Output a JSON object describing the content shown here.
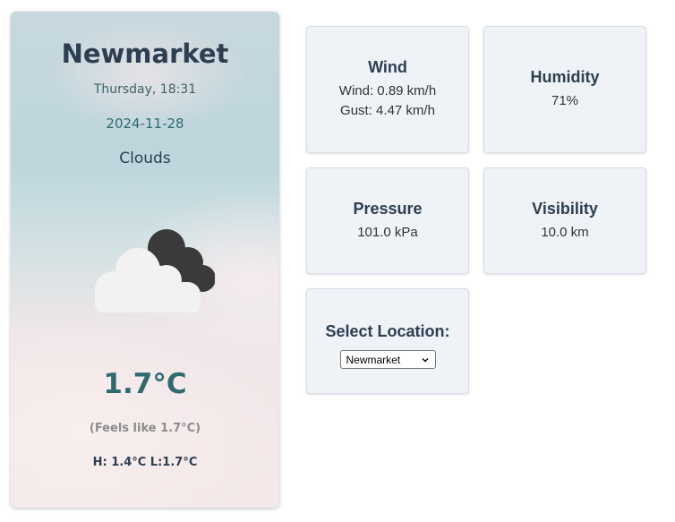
{
  "current": {
    "city": "Newmarket",
    "daytime": "Thursday, 18:31",
    "date": "2024-11-28",
    "condition": "Clouds",
    "condition_icon": "clouds-icon",
    "temperature": "1.7°C",
    "feels_like": "(Feels like 1.7°C)",
    "high_low": "H: 1.4°C L:1.7°C"
  },
  "tiles": {
    "wind": {
      "title": "Wind",
      "speed": "Wind: 0.89 km/h",
      "gust": "Gust: 4.47 km/h"
    },
    "humidity": {
      "title": "Humidity",
      "value": "71%"
    },
    "pressure": {
      "title": "Pressure",
      "value": "101.0 kPa"
    },
    "visibility": {
      "title": "Visibility",
      "value": "10.0 km"
    }
  },
  "location": {
    "label": "Select Location:",
    "selected": "Newmarket"
  },
  "colors": {
    "heading": "#2c3e50",
    "accent_teal": "#2f6b6e",
    "tile_bg": "#eff2f7",
    "muted": "#8c8c8c"
  }
}
